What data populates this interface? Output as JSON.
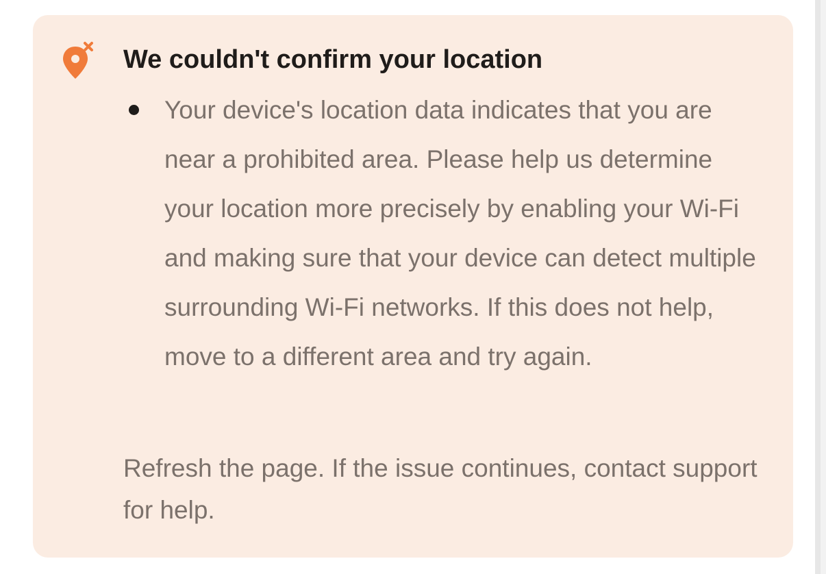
{
  "alert": {
    "icon": "location-pin-x-icon",
    "accent_color": "#f07b3a",
    "background_color": "#fbece2",
    "title": "We couldn't confirm your location",
    "bullets": [
      "Your device's location data indicates that you are near a prohibited area. Please help us determine your location more precisely by enabling your Wi-Fi and making sure that your device can detect multiple surrounding Wi-Fi networks. If this does not help, move to a different area and try again."
    ],
    "footer": "Refresh the page. If the issue continues, contact support for help."
  }
}
